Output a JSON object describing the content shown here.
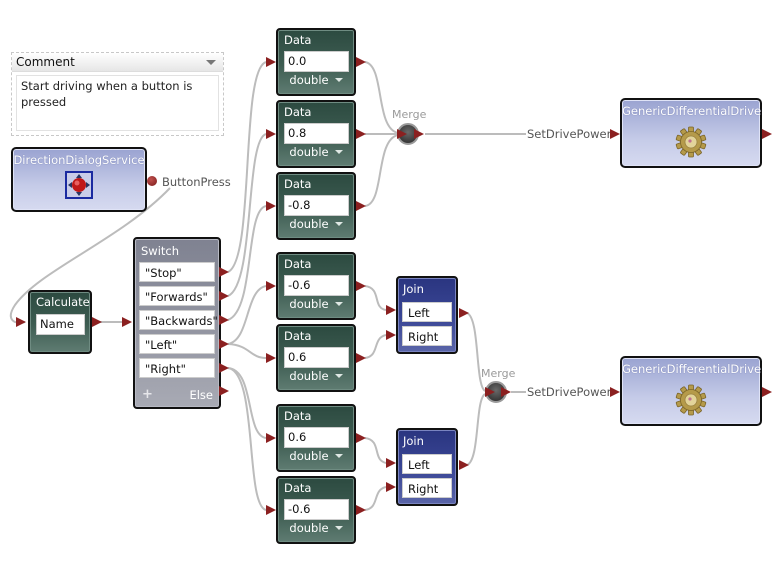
{
  "comment": {
    "header": "Comment",
    "text": "Start driving when a button is pressed"
  },
  "direction_service": {
    "title": "DirectionDialogService",
    "icon": "direction-pad-icon",
    "event_label": "ButtonPress"
  },
  "calculate": {
    "title": "Calculate",
    "expression": "Name"
  },
  "switch": {
    "title": "Switch",
    "cases": [
      "\"Stop\"",
      "\"Forwards\"",
      "\"Backwards\"",
      "\"Left\"",
      "\"Right\""
    ],
    "add_label": "+",
    "else_label": "Else"
  },
  "data_nodes": [
    {
      "title": "Data",
      "value": "0.0",
      "type": "double"
    },
    {
      "title": "Data",
      "value": "0.8",
      "type": "double"
    },
    {
      "title": "Data",
      "value": "-0.8",
      "type": "double"
    },
    {
      "title": "Data",
      "value": "-0.6",
      "type": "double"
    },
    {
      "title": "Data",
      "value": "0.6",
      "type": "double"
    },
    {
      "title": "Data",
      "value": "0.6",
      "type": "double"
    },
    {
      "title": "Data",
      "value": "-0.6",
      "type": "double"
    }
  ],
  "joins": [
    {
      "title": "Join",
      "ports": [
        "Left",
        "Right"
      ]
    },
    {
      "title": "Join",
      "ports": [
        "Left",
        "Right"
      ]
    }
  ],
  "merges": [
    {
      "label": "Merge"
    },
    {
      "label": "Merge"
    }
  ],
  "drives": [
    {
      "title": "GenericDifferentialDrive",
      "icon": "gear-icon",
      "operation": "SetDrivePower"
    },
    {
      "title": "GenericDifferentialDrive",
      "icon": "gear-icon",
      "operation": "SetDrivePower"
    }
  ],
  "colors": {
    "wire": "#bcbcbc",
    "pin": "#8b2020",
    "activity": "#3e5d52",
    "service": "#b4bbe0",
    "join": "#3b4796",
    "switch": "#9698a4"
  }
}
